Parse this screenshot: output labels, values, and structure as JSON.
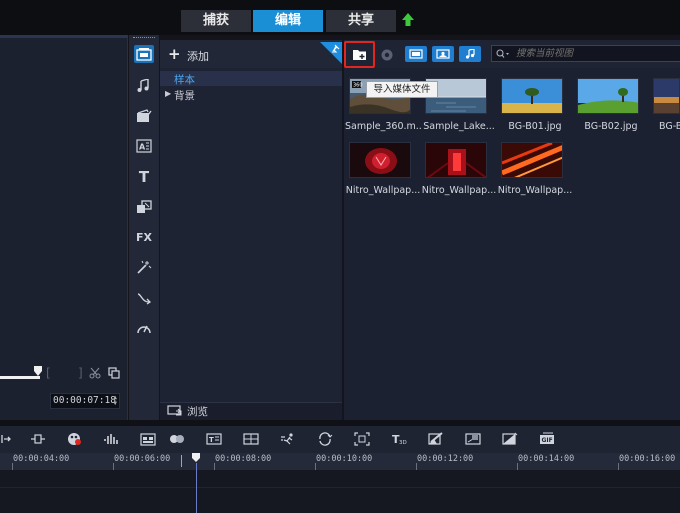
{
  "top_tabs": [
    {
      "label": "捕获",
      "active": false
    },
    {
      "label": "编辑",
      "active": true
    },
    {
      "label": "共享",
      "active": false
    }
  ],
  "preview": {
    "timecode": "00:00:07:18",
    "in_bracket": "[",
    "out_bracket": "]"
  },
  "library_nav": {
    "add_label": "添加",
    "folders": [
      {
        "label": "样本",
        "selected": true
      },
      {
        "label": "背景",
        "selected": false
      }
    ],
    "browse_label": "浏览"
  },
  "side_tools": [
    {
      "icon": "media-icon",
      "selected": true
    },
    {
      "icon": "audio-icon"
    },
    {
      "icon": "instant-project-icon"
    },
    {
      "icon": "title-icon"
    },
    {
      "icon": "text-icon",
      "glyph": "T"
    },
    {
      "icon": "transition-icon"
    },
    {
      "icon": "fx-icon",
      "glyph": "FX"
    },
    {
      "icon": "magic-wand-icon"
    },
    {
      "icon": "path-icon"
    },
    {
      "icon": "speedometer-icon"
    }
  ],
  "library": {
    "search_placeholder": "搜索当前视图",
    "tooltip": "导入媒体文件",
    "items": [
      {
        "label": "Sample_360.m...",
        "kind": "360"
      },
      {
        "label": "Sample_Lake...",
        "kind": "lake"
      },
      {
        "label": "BG-B01.jpg",
        "kind": "b01"
      },
      {
        "label": "BG-B02.jpg",
        "kind": "b02"
      },
      {
        "label": "BG-B",
        "kind": "b03"
      },
      {
        "label": "Nitro_Wallpap...",
        "kind": "nitro1"
      },
      {
        "label": "Nitro_Wallpap...",
        "kind": "nitro2"
      },
      {
        "label": "Nitro_Wallpap...",
        "kind": "nitro3"
      }
    ]
  },
  "timeline": {
    "ticks": [
      "00:00:04:00",
      "00:00:06:00",
      "00:00:08:00",
      "00:00:10:00",
      "00:00:12:00",
      "00:00:14:00",
      "00:00:16:00"
    ]
  },
  "colors": {
    "accent": "#1b8fd6",
    "highlight": "#e0261e",
    "upload": "#3cc93c"
  }
}
